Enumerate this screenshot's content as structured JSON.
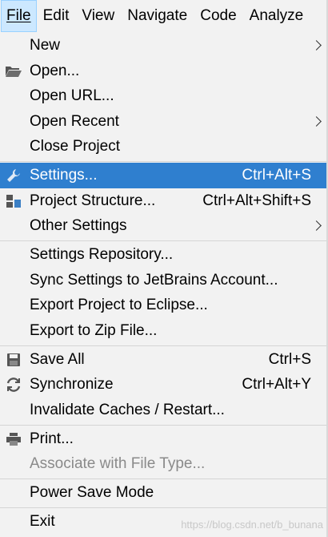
{
  "menubar": {
    "items": [
      {
        "label": "File"
      },
      {
        "label": "Edit"
      },
      {
        "label": "View"
      },
      {
        "label": "Navigate"
      },
      {
        "label": "Code"
      },
      {
        "label": "Analyze"
      }
    ]
  },
  "menu": {
    "new": {
      "label": "New"
    },
    "open": {
      "label": "Open..."
    },
    "open_url": {
      "label": "Open URL..."
    },
    "open_recent": {
      "label": "Open Recent"
    },
    "close_project": {
      "label": "Close Project"
    },
    "settings": {
      "label": "Settings...",
      "shortcut": "Ctrl+Alt+S"
    },
    "project_structure": {
      "label": "Project Structure...",
      "shortcut": "Ctrl+Alt+Shift+S"
    },
    "other_settings": {
      "label": "Other Settings"
    },
    "settings_repository": {
      "label": "Settings Repository..."
    },
    "sync_settings": {
      "label": "Sync Settings to JetBrains Account..."
    },
    "export_eclipse": {
      "label": "Export Project to Eclipse..."
    },
    "export_zip": {
      "label": "Export to Zip File..."
    },
    "save_all": {
      "label": "Save All",
      "shortcut": "Ctrl+S"
    },
    "synchronize": {
      "label": "Synchronize",
      "shortcut": "Ctrl+Alt+Y"
    },
    "invalidate": {
      "label": "Invalidate Caches / Restart..."
    },
    "print": {
      "label": "Print..."
    },
    "associate": {
      "label": "Associate with File Type..."
    },
    "power_save": {
      "label": "Power Save Mode"
    },
    "exit": {
      "label": "Exit"
    }
  },
  "watermark": "https://blog.csdn.net/b_bunana",
  "colors": {
    "highlight": "#2f7fcf",
    "menubar_active": "#cce8ff",
    "disabled": "#8a8a8a"
  }
}
